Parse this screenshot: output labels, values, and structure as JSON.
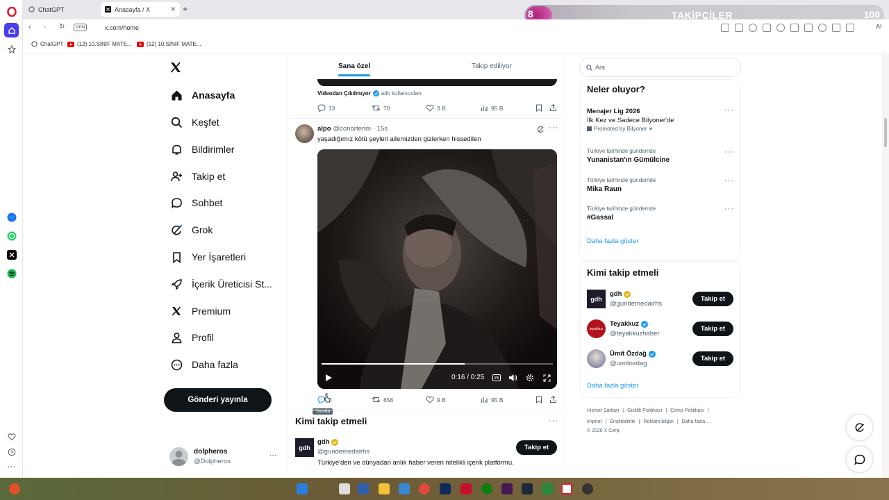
{
  "browser": {
    "tabs": [
      {
        "label": "ChatGPT",
        "active": false
      },
      {
        "label": "Anasayfa / X",
        "active": true
      }
    ],
    "new_tab_label": "+",
    "url": "x.com/home",
    "vpn_label": "VPN",
    "bookmarks": [
      "ChatGPT",
      "(12) 10.SINIF MATE...",
      "(12) 10.SINIF MATE..."
    ],
    "ai_label": "AI"
  },
  "overlay": {
    "count": "8",
    "title": "TAKİPÇİLER",
    "goal": "100"
  },
  "nav": {
    "items": [
      {
        "label": "Anasayfa",
        "icon": "home-icon",
        "active": true
      },
      {
        "label": "Keşfet",
        "icon": "search-icon"
      },
      {
        "label": "Bildirimler",
        "icon": "bell-icon"
      },
      {
        "label": "Takip et",
        "icon": "person-add-icon"
      },
      {
        "label": "Sohbet",
        "icon": "chat-icon"
      },
      {
        "label": "Grok",
        "icon": "grok-icon"
      },
      {
        "label": "Yer İşaretleri",
        "icon": "bookmark-icon"
      },
      {
        "label": "İçerik Üreticisi St...",
        "icon": "rocket-icon"
      },
      {
        "label": "Premium",
        "icon": "x-logo-icon"
      },
      {
        "label": "Profil",
        "icon": "profile-icon"
      },
      {
        "label": "Daha fazla",
        "icon": "more-circle-icon"
      }
    ],
    "post_button": "Gönderi yayınla",
    "account": {
      "name": "dolpheros",
      "handle": "@Dolpheros",
      "more": "···"
    }
  },
  "feed": {
    "tabs": [
      {
        "label": "Sana özel",
        "active": true
      },
      {
        "label": "Takip ediliyor",
        "active": false
      }
    ],
    "prev_post": {
      "caption_name": "Videodan Çıkılmıyor",
      "caption_suffix": "adlı kullanıcıdan",
      "replies": "13",
      "reposts": "70",
      "likes": "3 B",
      "views": "95 B"
    },
    "post": {
      "author": "alpo",
      "handle": "@conorterim",
      "time": "· 15s",
      "text": "yaşadığımız kötü şeyleri ailemizden gizlerken hissedilen",
      "video_time": "0:16 / 0:25",
      "video_progress": 0.62,
      "replies": "0",
      "reposts": "856",
      "likes": "9 B",
      "views": "95 B",
      "tooltip": "Yanıtla"
    },
    "who_to_follow": {
      "title": "Kimi takip etmeli",
      "item": {
        "avatar_text": "gdh",
        "name": "gdh",
        "handle": "@gundemedairhs",
        "bio": "Türkiye'den ve dünyadan anlık haber veren nitelikli içerik platformu.",
        "button": "Takip et"
      }
    }
  },
  "sidebar": {
    "search_placeholder": "Ara",
    "trends_title": "Neler oluyor?",
    "promoted": {
      "title": "Menajer Lig 2026",
      "subtitle": "İlk Kez ve Sadece Bilyoner'de",
      "promoted_by": "Promoted by Bilyoner"
    },
    "trends": [
      {
        "context": "Türkiye tarihinde gündemde",
        "name": "Yunanistan'ın Gümülcine"
      },
      {
        "context": "Türkiye tarihinde gündemde",
        "name": "Mika Raun"
      },
      {
        "context": "Türkiye tarihinde gündemde",
        "name": "#Gassal"
      }
    ],
    "show_more": "Daha fazla göster",
    "follow_title": "Kimi takip etmeli",
    "follow": [
      {
        "avatar_text": "gdh",
        "name": "gdh",
        "handle": "@gundemedairhs",
        "button": "Takip et",
        "badge": "gold"
      },
      {
        "avatar_text": "teyakkuz",
        "name": "Teyakkuz",
        "handle": "@teyakkuzhaber",
        "button": "Takip et",
        "badge": "blue"
      },
      {
        "avatar_text": "",
        "name": "Ümit Özdağ",
        "handle": "@umitozdag",
        "button": "Takip et",
        "badge": "blue"
      }
    ],
    "show_more_2": "Daha fazla göster",
    "footer": {
      "row1": [
        "Hizmet Şartları",
        "|",
        "Gizlilik Politikası",
        "|",
        "Çerez Politikası",
        "|"
      ],
      "row2": [
        "Imprint",
        "|",
        "Erişilebilirlik",
        "|",
        "Reklam bilgisi",
        "|",
        "Daha fazla ..."
      ],
      "copyright": "© 2026 X Corp."
    }
  },
  "colors": {
    "accent": "#1d9bf0",
    "text": "#0f1419",
    "muted": "#536471",
    "opera_red": "#e01e32"
  }
}
